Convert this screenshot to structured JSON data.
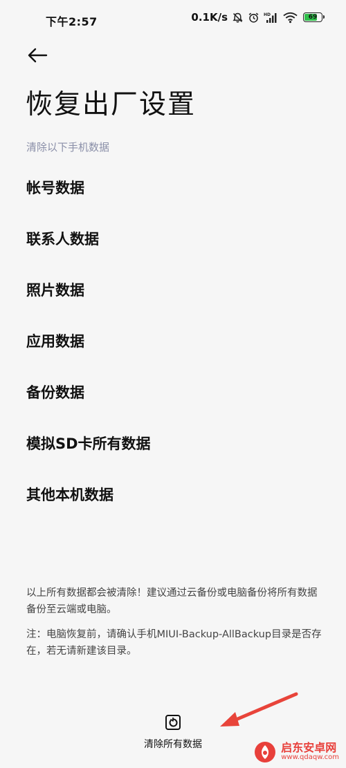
{
  "status_bar": {
    "time": "下午2:57",
    "network_speed": "0.1K/s",
    "battery_level": "69",
    "icons": [
      "bell-muted-icon",
      "alarm-icon",
      "signal-icon",
      "wifi-icon",
      "battery-icon"
    ]
  },
  "header": {
    "back_icon": "arrow-left-icon",
    "title": "恢复出厂设置"
  },
  "section": {
    "header": "清除以下手机数据",
    "items": [
      {
        "label": "帐号数据"
      },
      {
        "label": "联系人数据"
      },
      {
        "label": "照片数据"
      },
      {
        "label": "应用数据"
      },
      {
        "label": "备份数据"
      },
      {
        "label": "模拟SD卡所有数据"
      },
      {
        "label": "其他本机数据"
      }
    ]
  },
  "notices": {
    "warning": "以上所有数据都会被清除！建议通过云备份或电脑备份将所有数据备份至云端或电脑。",
    "note": "注：电脑恢复前，请确认手机MIUI-Backup-AllBackup目录是否存在，若无请新建该目录。"
  },
  "actions": {
    "clear_all_label": "清除所有数据",
    "clear_all_icon": "reset-icon"
  },
  "annotation": {
    "arrow_color": "#e8443a"
  },
  "watermark": {
    "brand": "启东安卓网",
    "site": "www.qdaqw.com"
  },
  "colors": {
    "background": "#f6f6f6",
    "section_header": "#8a8fa8",
    "battery_fill": "#2fbf4a",
    "accent_red": "#e8403b"
  }
}
